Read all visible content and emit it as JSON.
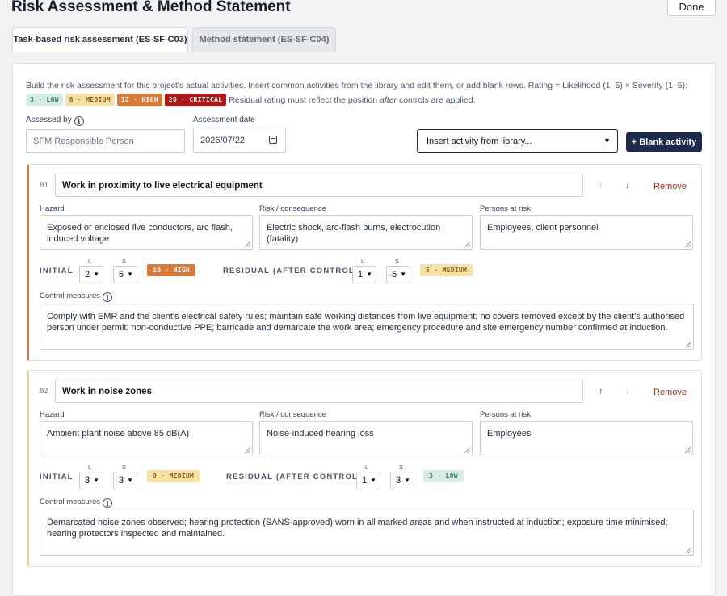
{
  "page": {
    "title": "Risk Assessment & Method Statement",
    "done_label": "Done"
  },
  "tabs": [
    {
      "label": "Task-based risk assessment (ES-SF-C03)",
      "active": true
    },
    {
      "label": "Method statement (ES-SF-C04)",
      "active": false
    }
  ],
  "intro": {
    "text": "Build the risk assessment for this project's actual activities. Insert common activities from the library and edit them, or add blank rows. Rating = Likelihood (1–5) × Severity (1–5):",
    "badges": [
      {
        "label": "3 · LOW",
        "level": "low"
      },
      {
        "label": "8 · MEDIUM",
        "level": "medium"
      },
      {
        "label": "12 · HIGH",
        "level": "high"
      },
      {
        "label": "20 · CRITICAL",
        "level": "critical"
      }
    ],
    "residual_note_pre": "Residual rating must reflect the position ",
    "residual_note_em": "after",
    "residual_note_post": " controls are applied."
  },
  "header_fields": {
    "assessed_by_label": "Assessed by",
    "assessed_by_placeholder": "SFM Responsible Person",
    "assessment_date_label": "Assessment date",
    "assessment_date_value": "2026/07/22",
    "library_select_value": "Insert activity from library...",
    "blank_activity_label": "+ Blank activity"
  },
  "labels": {
    "hazard": "Hazard",
    "risk": "Risk / consequence",
    "persons": "Persons at risk",
    "initial": "INITIAL",
    "residual": "RESIDUAL (AFTER CONTROLS)",
    "l": "L",
    "s": "S",
    "control_measures": "Control measures",
    "remove": "Remove",
    "up": "↑",
    "down": "↓"
  },
  "activities": [
    {
      "number": "01",
      "title": "Work in proximity to live electrical equipment",
      "hazard": "Exposed or enclosed live conductors, arc flash, induced voltage",
      "risk": "Electric shock, arc-flash burns, electrocution (fatality)",
      "persons": "Employees, client personnel",
      "initial_l": "2",
      "initial_s": "5",
      "initial_rating": "10 · HIGH",
      "residual_l": "1",
      "residual_s": "5",
      "residual_rating": "5 · MEDIUM",
      "controls": "Comply with EMR and the client's electrical safety rules; maintain safe working distances from live equipment; no covers removed except by the client's authorised person under permit; non-conductive PPE; barricade and demarcate the work area; emergency procedure and site emergency number confirmed at induction.",
      "accent_color": "#d97a3a"
    },
    {
      "number": "02",
      "title": "Work in noise zones",
      "hazard": "Ambient plant noise above 85 dB(A)",
      "risk": "Noise-induced hearing loss",
      "persons": "Employees",
      "initial_l": "3",
      "initial_s": "3",
      "initial_rating": "9 · MEDIUM",
      "residual_l": "1",
      "residual_s": "3",
      "residual_rating": "3 · LOW",
      "controls": "Demarcated noise zones observed; hearing protection (SANS-approved) worn in all marked areas and when instructed at induction; exposure time minimised; hearing protectors inspected and maintained.",
      "accent_color": "#f2d38a"
    }
  ],
  "colors": {
    "low_bg": "#d7ece6",
    "medium_bg": "#f6e2a6",
    "high_bg": "#d97a3a",
    "critical_bg": "#b01818",
    "primary_button": "#1e2a4a",
    "remove_text": "#8b2a16"
  }
}
